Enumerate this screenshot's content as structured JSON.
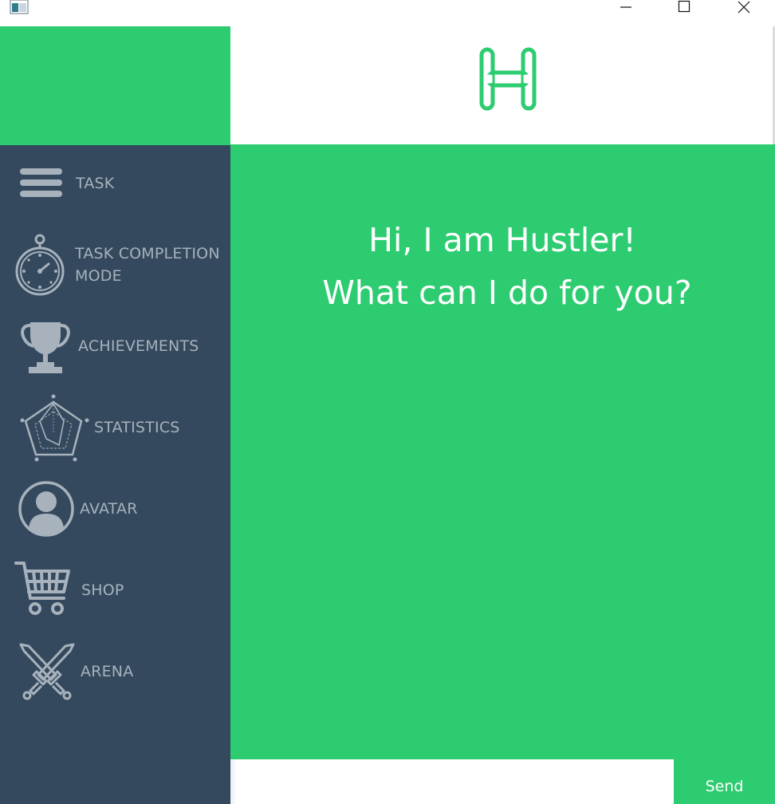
{
  "window": {
    "controls": [
      "minimize",
      "maximize",
      "close"
    ]
  },
  "colors": {
    "accent_green": "#2ecc71",
    "sidebar_bg": "#34495e",
    "sidebar_text": "#a7b2bc",
    "text_white": "#ffffff"
  },
  "header": {
    "logo_icon": "hustler-h-logo-icon"
  },
  "sidebar": {
    "items": [
      {
        "label": "TASK",
        "icon": "menu-lines-icon"
      },
      {
        "label": "TASK COMPLETION",
        "label_line2": "MODE",
        "icon": "stopwatch-icon"
      },
      {
        "label": "ACHIEVEMENTS",
        "icon": "trophy-icon"
      },
      {
        "label": "STATISTICS",
        "icon": "radar-chart-icon"
      },
      {
        "label": "AVATAR",
        "icon": "user-avatar-icon"
      },
      {
        "label": "SHOP",
        "icon": "shopping-cart-icon"
      },
      {
        "label": "ARENA",
        "icon": "crossed-swords-icon"
      }
    ]
  },
  "main": {
    "greeting_line1": "Hi, I am Hustler!",
    "greeting_line2": "What can I do for you?"
  },
  "chat": {
    "input_value": "",
    "send_label": "Send"
  }
}
